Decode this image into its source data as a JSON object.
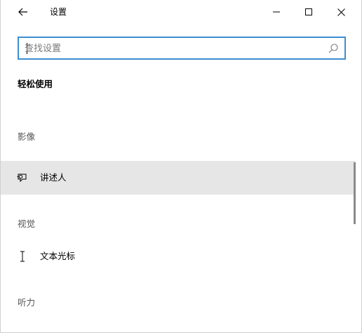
{
  "window": {
    "title": "设置"
  },
  "search": {
    "value": "",
    "placeholder": "查找设置"
  },
  "page": {
    "heading": "轻松使用"
  },
  "sections": [
    {
      "label": "影像",
      "items": [
        {
          "label": "讲述人",
          "icon": "narrator-icon",
          "selected": true
        }
      ]
    },
    {
      "label": "视觉",
      "items": [
        {
          "label": "文本光标",
          "icon": "text-cursor-icon",
          "selected": false
        }
      ]
    },
    {
      "label": "听力",
      "items": []
    }
  ],
  "colors": {
    "accent": "#3d8ed2",
    "selected_bg": "#e6e6e6",
    "section_text": "#555555"
  }
}
